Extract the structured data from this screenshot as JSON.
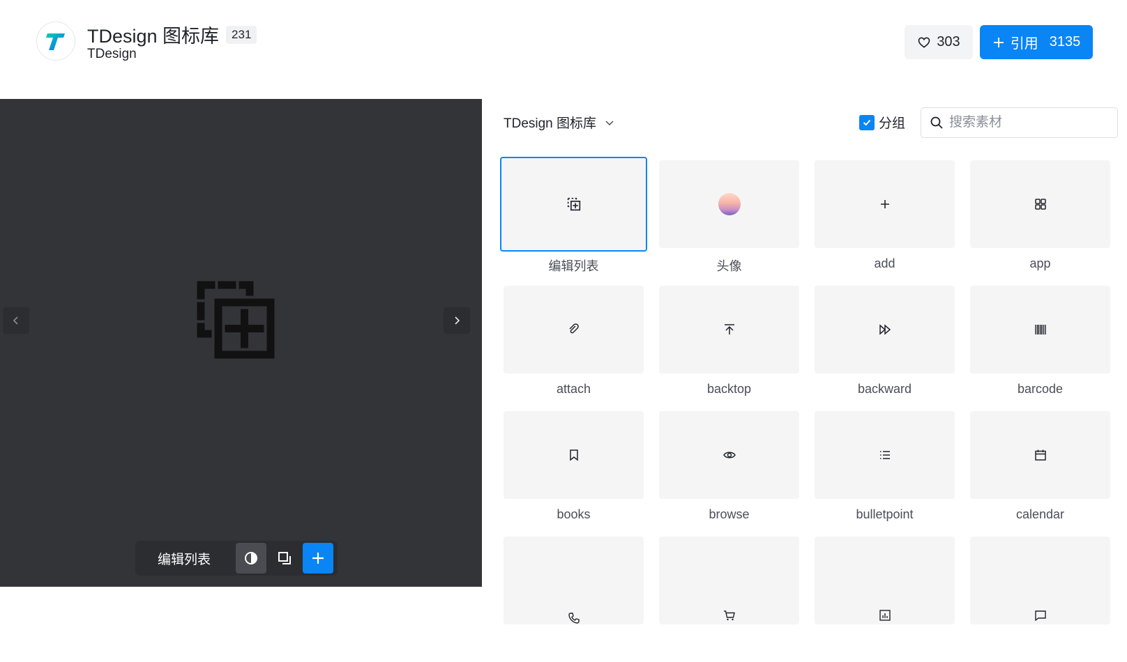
{
  "header": {
    "library_title": "TDesign 图标库",
    "icon_count": "231",
    "author": "TDesign",
    "like_count": "303",
    "cite_label": "引用",
    "cite_count": "3135"
  },
  "preview": {
    "icon_name": "编辑列表"
  },
  "panel": {
    "library_select": "TDesign 图标库",
    "group_label": "分组",
    "group_checked": true,
    "search_placeholder": "搜索素材"
  },
  "icons": [
    {
      "label": "编辑列表",
      "icon": "edit-list-icon",
      "selected": true
    },
    {
      "label": "头像",
      "icon": "avatar-icon"
    },
    {
      "label": "add",
      "icon": "add-icon"
    },
    {
      "label": "app",
      "icon": "app-icon"
    },
    {
      "label": "attach",
      "icon": "attach-icon"
    },
    {
      "label": "backtop",
      "icon": "backtop-icon"
    },
    {
      "label": "backward",
      "icon": "backward-icon"
    },
    {
      "label": "barcode",
      "icon": "barcode-icon"
    },
    {
      "label": "books",
      "icon": "books-icon"
    },
    {
      "label": "browse",
      "icon": "browse-icon"
    },
    {
      "label": "bulletpoint",
      "icon": "bulletpoint-icon"
    },
    {
      "label": "calendar",
      "icon": "calendar-icon"
    },
    {
      "label": "",
      "icon": "call-icon"
    },
    {
      "label": "",
      "icon": "cart-icon"
    },
    {
      "label": "",
      "icon": "chart-icon"
    },
    {
      "label": "",
      "icon": "chat-icon"
    }
  ],
  "colors": {
    "brand": "#0a85f5",
    "preview_bg": "#323438",
    "tile_bg": "#f5f5f6"
  }
}
